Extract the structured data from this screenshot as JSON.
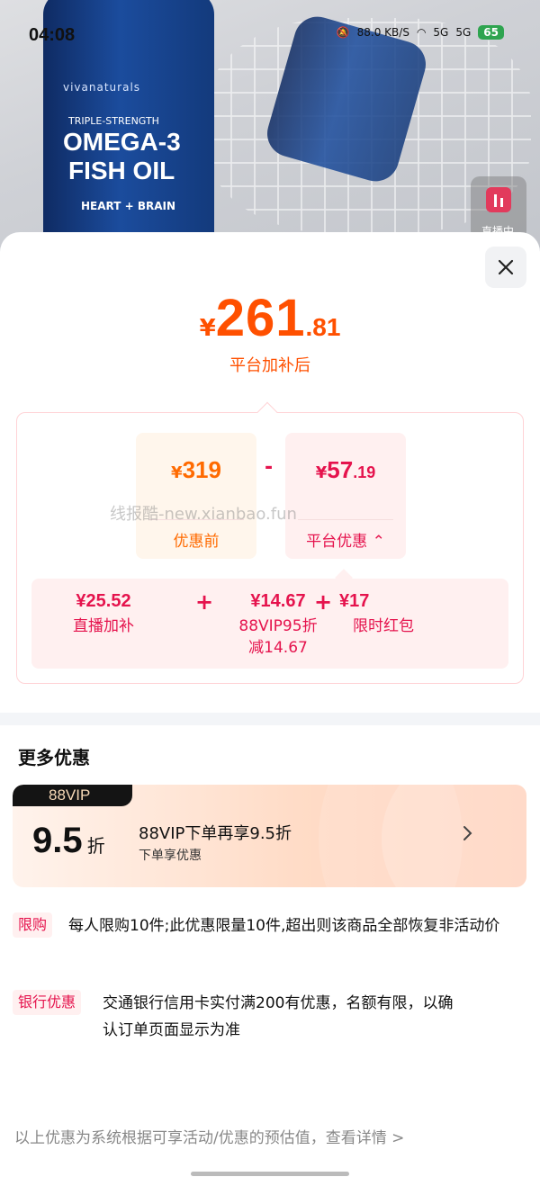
{
  "status_bar": {
    "time": "04:08",
    "net_speed": "88.0 KB/S",
    "signal_1": "5G",
    "signal_2": "5G",
    "battery": "65"
  },
  "background": {
    "brand": "vivanaturals",
    "strength": "TRIPLE-STRENGTH",
    "product_line1": "OMEGA-3",
    "product_line2": "FISH OIL",
    "supports": "HEART + BRAIN",
    "live_label": "直播中"
  },
  "price": {
    "currency": "¥",
    "integer": "261",
    "decimal": ".81",
    "label": "平台加补后"
  },
  "breakdown": {
    "before": {
      "currency": "¥",
      "amount": "319",
      "decimal": "",
      "label": "优惠前"
    },
    "operator": "-",
    "platform": {
      "currency": "¥",
      "amount": "57",
      "decimal": ".19",
      "label": "平台优惠"
    },
    "watermark": "线报酷-new.xianbao.fun",
    "subs": [
      {
        "value": "¥25.52",
        "label": "直播加补",
        "label2": ""
      },
      {
        "value": "¥14.67",
        "label": "88VIP95折",
        "label2": "减14.67"
      },
      {
        "value": "¥17",
        "label": "限时红包",
        "label2": ""
      }
    ],
    "plus": "+"
  },
  "more": {
    "title": "更多优惠",
    "vip_card": {
      "tag": "88VIP",
      "discount": "9.5",
      "discount_unit": "折",
      "title": "88VIP下单再享9.5折",
      "subtitle": "下单享优惠"
    },
    "rules": [
      {
        "tag": "限购",
        "text": "每人限购10件;此优惠限量10件,超出则该商品全部恢复非活动价"
      },
      {
        "tag": "银行优惠",
        "text": "交通银行信用卡实付满200有优惠，名额有限，以确认订单页面显示为准"
      }
    ]
  },
  "footer": {
    "note": "以上优惠为系统根据可享活动/优惠的预估值，查看详情 >"
  },
  "colors": {
    "price_orange": "#ff5000",
    "discount_red": "#e5134d",
    "battery_green": "#2ea44f"
  }
}
